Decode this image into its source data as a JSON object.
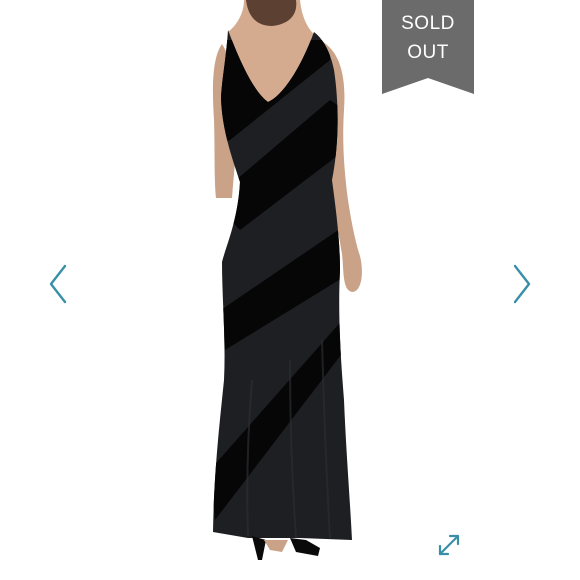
{
  "badge": {
    "line1": "SOLD",
    "line2": "OUT",
    "color": "#6b6b6b"
  },
  "nav": {
    "prev_icon": "chevron-left-icon",
    "next_icon": "chevron-right-icon",
    "accent": "#3a8fa8"
  },
  "expand": {
    "icon": "expand-arrows-icon"
  },
  "photo": {
    "subject": "product-photo"
  }
}
